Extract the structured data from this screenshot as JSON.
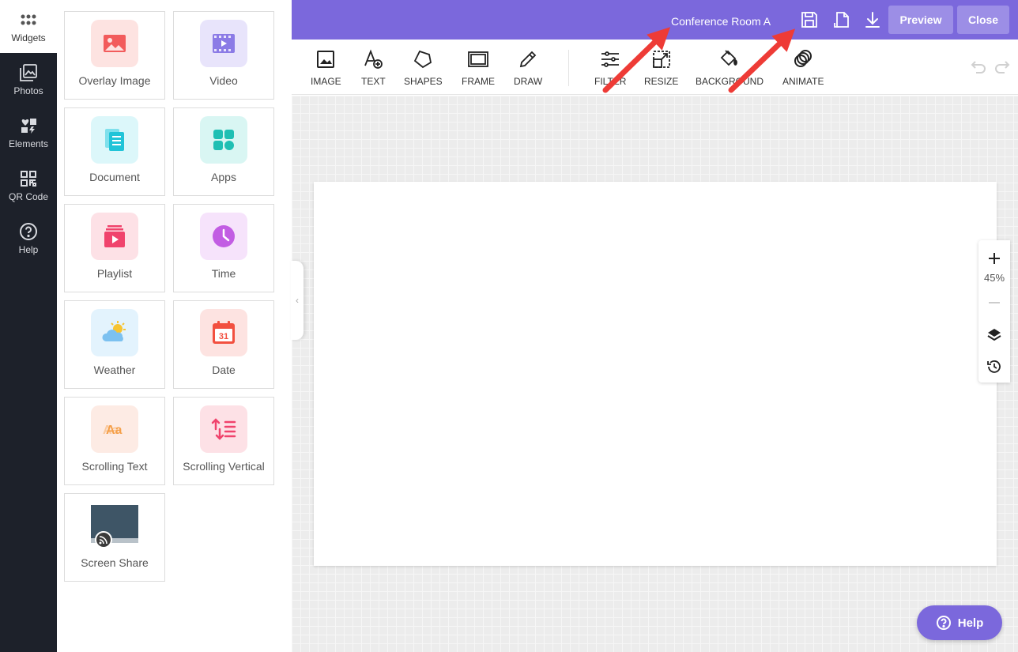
{
  "nav": {
    "items": [
      {
        "label": "Widgets",
        "icon": "grid-icon"
      },
      {
        "label": "Photos",
        "icon": "photos-icon"
      },
      {
        "label": "Elements",
        "icon": "elements-icon"
      },
      {
        "label": "QR Code",
        "icon": "qr-code-icon"
      },
      {
        "label": "Help",
        "icon": "help-circle-icon"
      }
    ]
  },
  "widgets": [
    {
      "label": "Overlay Image",
      "icon": "overlay-image-icon",
      "color": "#f25c5c",
      "bg": "#fde3e1"
    },
    {
      "label": "Video",
      "icon": "video-icon",
      "color": "#8b7be6",
      "bg": "#e8e4fb"
    },
    {
      "label": "Document",
      "icon": "document-icon",
      "color": "#21c4d8",
      "bg": "#dcf7fa"
    },
    {
      "label": "Apps",
      "icon": "apps-icon",
      "color": "#1fbfb3",
      "bg": "#d9f6f3"
    },
    {
      "label": "Playlist",
      "icon": "playlist-icon",
      "color": "#f0436c",
      "bg": "#fde1e6"
    },
    {
      "label": "Time",
      "icon": "clock-icon",
      "color": "#c25de3",
      "bg": "#f6e3fb"
    },
    {
      "label": "Weather",
      "icon": "weather-icon",
      "color": "#7cc1f0",
      "bg": "#e3f3fd"
    },
    {
      "label": "Date",
      "icon": "calendar-icon",
      "color": "#f25040",
      "bg": "#fde3e1"
    },
    {
      "label": "Scrolling Text",
      "icon": "scrolling-text-icon",
      "color": "#f5a04a",
      "bg": "#fdebe4"
    },
    {
      "label": "Scrolling Vertical",
      "icon": "scrolling-vertical-icon",
      "color": "#f0436c",
      "bg": "#fde1e6"
    },
    {
      "label": "Screen Share",
      "icon": "screen-share-icon",
      "color": "#3e5566",
      "bg": "#ffffff"
    }
  ],
  "header": {
    "title": "Conference Room A",
    "preview_label": "Preview",
    "close_label": "Close",
    "color": "#7b68dc"
  },
  "toolbar": {
    "tools": [
      {
        "label": "IMAGE",
        "icon": "image-icon"
      },
      {
        "label": "TEXT",
        "icon": "text-add-icon"
      },
      {
        "label": "SHAPES",
        "icon": "shapes-icon"
      },
      {
        "label": "FRAME",
        "icon": "frame-icon"
      },
      {
        "label": "DRAW",
        "icon": "pencil-icon"
      },
      {
        "label": "FILTER",
        "icon": "sliders-icon"
      },
      {
        "label": "RESIZE",
        "icon": "resize-icon"
      },
      {
        "label": "BACKGROUND",
        "icon": "paint-bucket-icon"
      },
      {
        "label": "ANIMATE",
        "icon": "animate-rings-icon"
      }
    ]
  },
  "zoom": {
    "level": "45%"
  },
  "help_button": {
    "label": "Help"
  }
}
